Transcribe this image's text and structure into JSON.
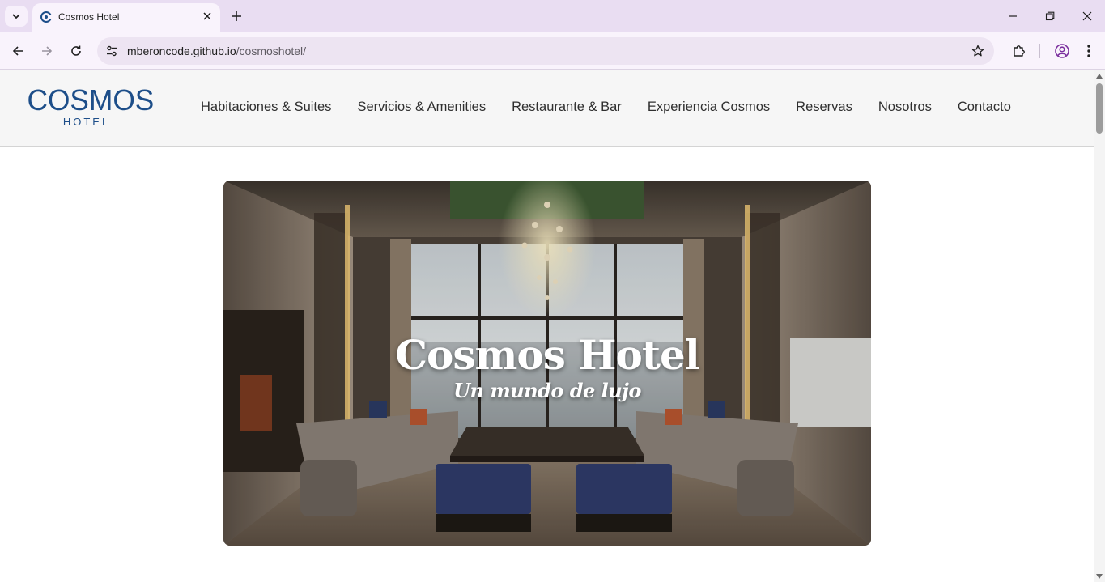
{
  "browser": {
    "tab_title": "Cosmos Hotel",
    "url_host": "mberoncode.github.io",
    "url_path": "/cosmoshotel/"
  },
  "site": {
    "logo_brand": "COSMOS",
    "logo_sub": "HOTEL",
    "nav": [
      "Habitaciones & Suites",
      "Servicios & Amenities",
      "Restaurante & Bar",
      "Experiencia Cosmos",
      "Reservas",
      "Nosotros",
      "Contacto"
    ]
  },
  "hero": {
    "title": "Cosmos Hotel",
    "subtitle": "Un mundo de lujo"
  },
  "colors": {
    "brand_blue": "#1d4e89",
    "chrome_tabstrip": "#e9ddf2",
    "chrome_toolbar": "#f9f3fc",
    "header_bg": "#f6f6f6"
  }
}
